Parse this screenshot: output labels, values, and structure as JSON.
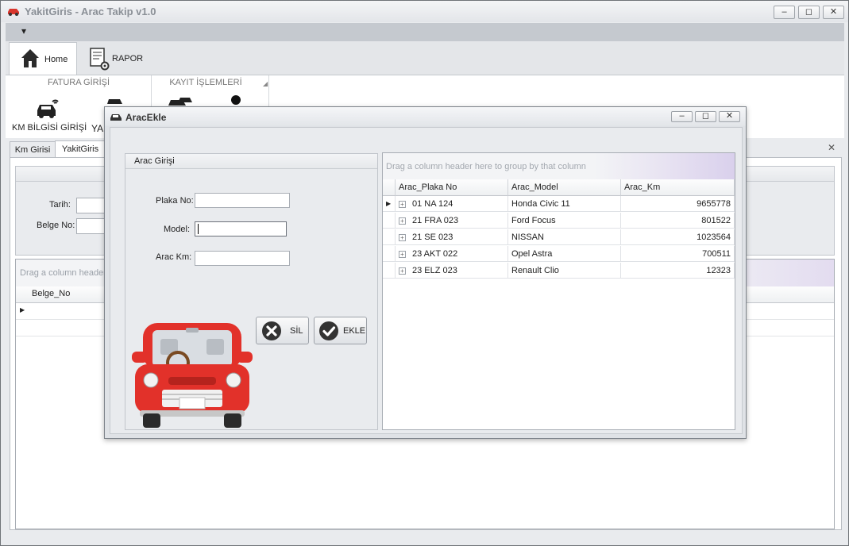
{
  "window": {
    "title": "YakitGiris - Arac Takip v1.0",
    "minimize": "‒",
    "restore": "◻",
    "close": "✕"
  },
  "qat": {
    "menu_arrow": "▾"
  },
  "ribbon": {
    "tabs": [
      {
        "label": "Home"
      },
      {
        "label": "RAPOR"
      }
    ],
    "groups": [
      {
        "caption": "FATURA GİRİŞİ"
      },
      {
        "caption": "KAYIT İŞLEMLERİ"
      }
    ],
    "buttons": [
      {
        "label": "KM BİLGİSİ GİRİŞİ"
      },
      {
        "label": "YAK"
      }
    ]
  },
  "document": {
    "tabs": [
      {
        "label": "Km Girisi"
      },
      {
        "label": "YakitGiris"
      }
    ],
    "close": "✕",
    "form": {
      "tarih_label": "Tarih:",
      "belge_label": "Belge No:"
    },
    "grid": {
      "group_hint": "Drag a column header",
      "columns": [
        "Belge_No"
      ]
    }
  },
  "dialog": {
    "title": "AracEkle",
    "group_caption": "Arac Girişi",
    "fields": [
      {
        "label": "Plaka No:",
        "value": ""
      },
      {
        "label": "Model:",
        "value": ""
      },
      {
        "label": "Arac Km:",
        "value": ""
      }
    ],
    "buttons": {
      "delete": "SİL",
      "add": "EKLE"
    },
    "grid": {
      "group_hint": "Drag a column header here to group by that column",
      "columns": [
        "Arac_Plaka No",
        "Arac_Model",
        "Arac_Km"
      ],
      "rows": [
        [
          "01 NA 124",
          "Honda Civic 11",
          "9655778"
        ],
        [
          "21 FRA 023",
          "Ford Focus",
          "801522"
        ],
        [
          "21 SE 023",
          "NISSAN",
          "1023564"
        ],
        [
          "23 AKT 022",
          "Opel Astra",
          "700511"
        ],
        [
          "23 ELZ 023",
          "Renault Clio",
          "12323"
        ]
      ],
      "current_row_indicator": "▶",
      "expander": "+"
    }
  },
  "colors": {
    "car_red": "#e2312a",
    "accent": "#2b2b2b"
  }
}
